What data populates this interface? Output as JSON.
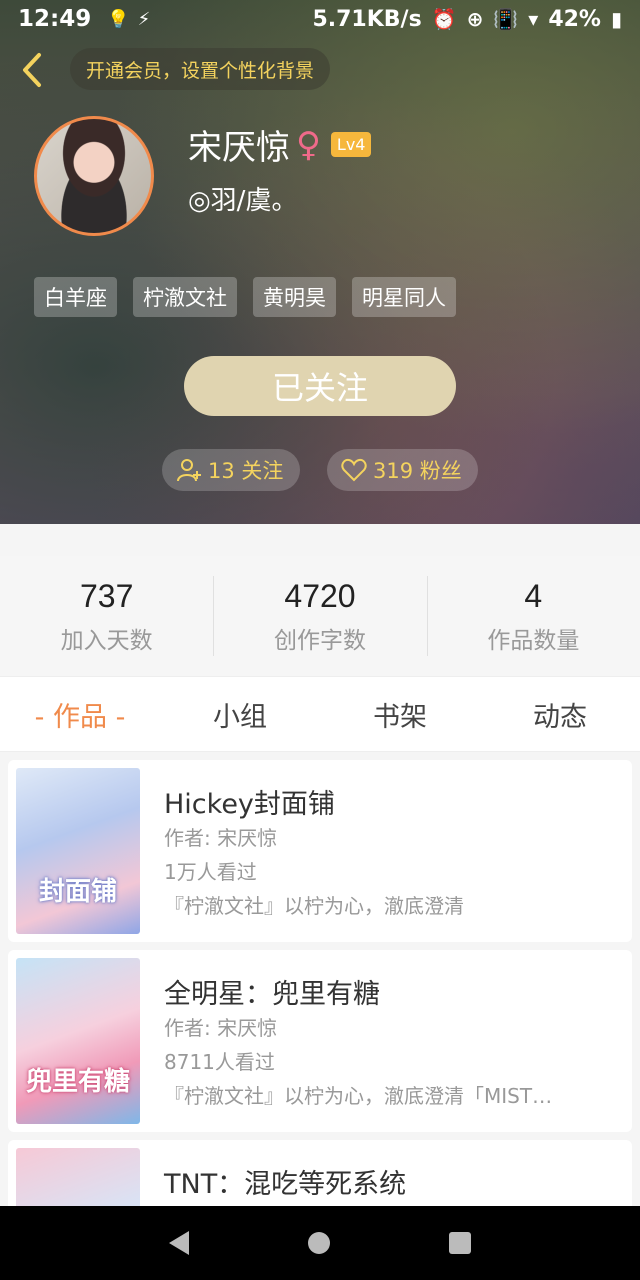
{
  "status_bar": {
    "time": "12:49",
    "net_speed": "5.71KB/s",
    "battery": "42%"
  },
  "header": {
    "vip_prompt": "开通会员，设置个性化背景",
    "username": "宋厌惊",
    "level": "Lv4",
    "signature": "◎羽/虞。",
    "tags": [
      "白羊座",
      "柠澈文社",
      "黄明昊",
      "明星同人"
    ],
    "follow_button": "已关注",
    "following_label": "13 关注",
    "fans_label": "319 粉丝"
  },
  "stats": [
    {
      "value": "737",
      "label": "加入天数"
    },
    {
      "value": "4720",
      "label": "创作字数"
    },
    {
      "value": "4",
      "label": "作品数量"
    }
  ],
  "tabs": [
    "- 作品 -",
    "小组",
    "书架",
    "动态"
  ],
  "works": [
    {
      "title": "Hickey封面铺",
      "author": "作者: 宋厌惊",
      "views": "1万人看过",
      "desc": "『柠澈文社』以柠为心，澈底澄清",
      "cover_text": "封面铺"
    },
    {
      "title": "全明星：兜里有糖",
      "author": "作者: 宋厌惊",
      "views": "8711人看过",
      "desc": "『柠澈文社』以柠为心，澈底澄清「MIST…",
      "cover_text": "兜里有糖"
    },
    {
      "title": "TNT：混吃等死系统",
      "author": "",
      "views": "",
      "desc": "",
      "cover_text": ""
    }
  ],
  "colors": {
    "accent": "#f08a4b",
    "gold_text": "#f4d35e",
    "follow_button_bg": "#e0d4b0"
  }
}
